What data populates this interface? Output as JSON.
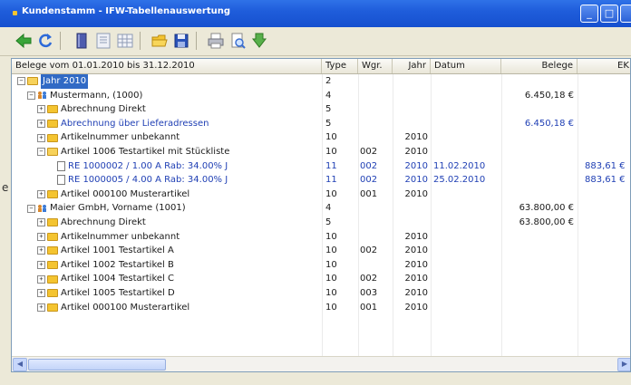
{
  "window": {
    "title": "Kundenstamm - IFW-Tabellenauswertung",
    "title_color": "#1f5ddb"
  },
  "toolbar": {
    "icons": [
      "back-arrow-icon",
      "refresh-icon",
      "book-icon",
      "list-view-icon",
      "grid-view-icon",
      "open-folder-icon",
      "save-icon",
      "print-icon",
      "print-preview-icon",
      "export-icon"
    ]
  },
  "side_mark": "e",
  "table": {
    "columns": {
      "name": "Belege vom 01.01.2010 bis 31.12.2010",
      "type": "Type",
      "wgr": "Wgr.",
      "jahr": "Jahr",
      "datum": "Datum",
      "belege": "Belege",
      "ek": "EK"
    },
    "rows": [
      {
        "level": 0,
        "exp": "-",
        "icon": "folder",
        "name": "Jahr 2010",
        "type": "2",
        "wgr": "",
        "jahr": "",
        "datum": "",
        "belege": "",
        "ek": "",
        "selected": true
      },
      {
        "level": 1,
        "exp": "-",
        "icon": "person",
        "name": "Mustermann,  (1000)",
        "type": "4",
        "wgr": "",
        "jahr": "",
        "datum": "",
        "belege": "6.450,18 €",
        "ek": ""
      },
      {
        "level": 2,
        "exp": "+",
        "icon": "folder",
        "name": "Abrechnung Direkt",
        "type": "5",
        "wgr": "",
        "jahr": "",
        "datum": "",
        "belege": "",
        "ek": ""
      },
      {
        "level": 2,
        "exp": "+",
        "icon": "folder",
        "name": "Abrechnung über Lieferadressen",
        "type": "5",
        "wgr": "",
        "jahr": "",
        "datum": "",
        "belege": "6.450,18 €",
        "ek": "",
        "blue": true
      },
      {
        "level": 2,
        "exp": "+",
        "icon": "folder",
        "name": "Artikelnummer unbekannt",
        "type": "10",
        "wgr": "",
        "jahr": "2010",
        "datum": "",
        "belege": "",
        "ek": ""
      },
      {
        "level": 2,
        "exp": "-",
        "icon": "folder",
        "name": "Artikel   1006 Testartikel mit Stückliste",
        "type": "10",
        "wgr": "002",
        "jahr": "2010",
        "datum": "",
        "belege": "",
        "ek": ""
      },
      {
        "level": 3,
        "exp": "",
        "icon": "doc",
        "name": "RE  1000002 / 1.00 A Rab: 34.00% J",
        "type": "11",
        "wgr": "002",
        "jahr": "2010",
        "datum": "11.02.2010",
        "belege": "",
        "ek": "883,61 €",
        "blue": true
      },
      {
        "level": 3,
        "exp": "",
        "icon": "doc",
        "name": "RE  1000005 / 4.00 A Rab: 34.00% J",
        "type": "11",
        "wgr": "002",
        "jahr": "2010",
        "datum": "25.02.2010",
        "belege": "",
        "ek": "883,61 €",
        "blue": true
      },
      {
        "level": 2,
        "exp": "+",
        "icon": "folder",
        "name": "Artikel 000100 Musterartikel",
        "type": "10",
        "wgr": "001",
        "jahr": "2010",
        "datum": "",
        "belege": "",
        "ek": ""
      },
      {
        "level": 1,
        "exp": "-",
        "icon": "person",
        "name": "Maier GmbH, Vorname (1001)",
        "type": "4",
        "wgr": "",
        "jahr": "",
        "datum": "",
        "belege": "63.800,00 €",
        "ek": ""
      },
      {
        "level": 2,
        "exp": "+",
        "icon": "folder",
        "name": "Abrechnung Direkt",
        "type": "5",
        "wgr": "",
        "jahr": "",
        "datum": "",
        "belege": "63.800,00 €",
        "ek": ""
      },
      {
        "level": 2,
        "exp": "+",
        "icon": "folder",
        "name": "Artikelnummer unbekannt",
        "type": "10",
        "wgr": "",
        "jahr": "2010",
        "datum": "",
        "belege": "",
        "ek": ""
      },
      {
        "level": 2,
        "exp": "+",
        "icon": "folder",
        "name": "Artikel   1001 Testartikel A",
        "type": "10",
        "wgr": "002",
        "jahr": "2010",
        "datum": "",
        "belege": "",
        "ek": ""
      },
      {
        "level": 2,
        "exp": "+",
        "icon": "folder",
        "name": "Artikel   1002 Testartikel B",
        "type": "10",
        "wgr": "",
        "jahr": "2010",
        "datum": "",
        "belege": "",
        "ek": ""
      },
      {
        "level": 2,
        "exp": "+",
        "icon": "folder",
        "name": "Artikel   1004 Testartikel C",
        "type": "10",
        "wgr": "002",
        "jahr": "2010",
        "datum": "",
        "belege": "",
        "ek": ""
      },
      {
        "level": 2,
        "exp": "+",
        "icon": "folder",
        "name": "Artikel   1005 Testartikel D",
        "type": "10",
        "wgr": "003",
        "jahr": "2010",
        "datum": "",
        "belege": "",
        "ek": ""
      },
      {
        "level": 2,
        "exp": "+",
        "icon": "folder",
        "name": "Artikel 000100 Musterartikel",
        "type": "10",
        "wgr": "001",
        "jahr": "2010",
        "datum": "",
        "belege": "",
        "ek": ""
      }
    ]
  }
}
